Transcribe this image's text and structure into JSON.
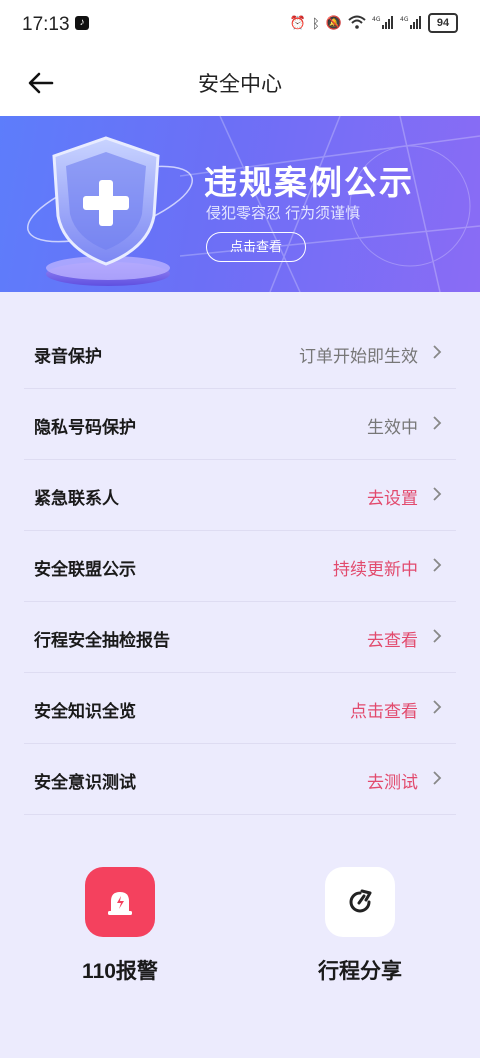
{
  "status_bar": {
    "time": "17:13",
    "battery": "94",
    "icons": [
      "alarm-icon",
      "bluetooth-icon",
      "mute-icon",
      "wifi-icon",
      "signal-4g-icon",
      "signal-4g-icon",
      "battery-icon"
    ]
  },
  "header": {
    "title": "安全中心",
    "back_icon": "arrow-left-icon"
  },
  "banner": {
    "title": "违规案例公示",
    "subtitle": "侵犯零容忍 行为须谨慎",
    "button": "点击查看",
    "icon": "shield-plus-icon"
  },
  "list": [
    {
      "label": "录音保护",
      "value": "订单开始即生效",
      "highlight": false
    },
    {
      "label": "隐私号码保护",
      "value": "生效中",
      "highlight": false
    },
    {
      "label": "紧急联系人",
      "value": "去设置",
      "highlight": true
    },
    {
      "label": "安全联盟公示",
      "value": "持续更新中",
      "highlight": true
    },
    {
      "label": "行程安全抽检报告",
      "value": "去查看",
      "highlight": true
    },
    {
      "label": "安全知识全览",
      "value": "点击查看",
      "highlight": true
    },
    {
      "label": "安全意识测试",
      "value": "去测试",
      "highlight": true
    }
  ],
  "actions": {
    "alarm": {
      "label": "110报警",
      "icon": "siren-icon"
    },
    "share": {
      "label": "行程分享",
      "icon": "share-trip-icon"
    }
  },
  "colors": {
    "accent_red": "#e24a6d",
    "alarm_red": "#f4415e",
    "banner_start": "#5d7dfb",
    "banner_end": "#8a6cf5",
    "page_bg": "#ecebfd"
  }
}
